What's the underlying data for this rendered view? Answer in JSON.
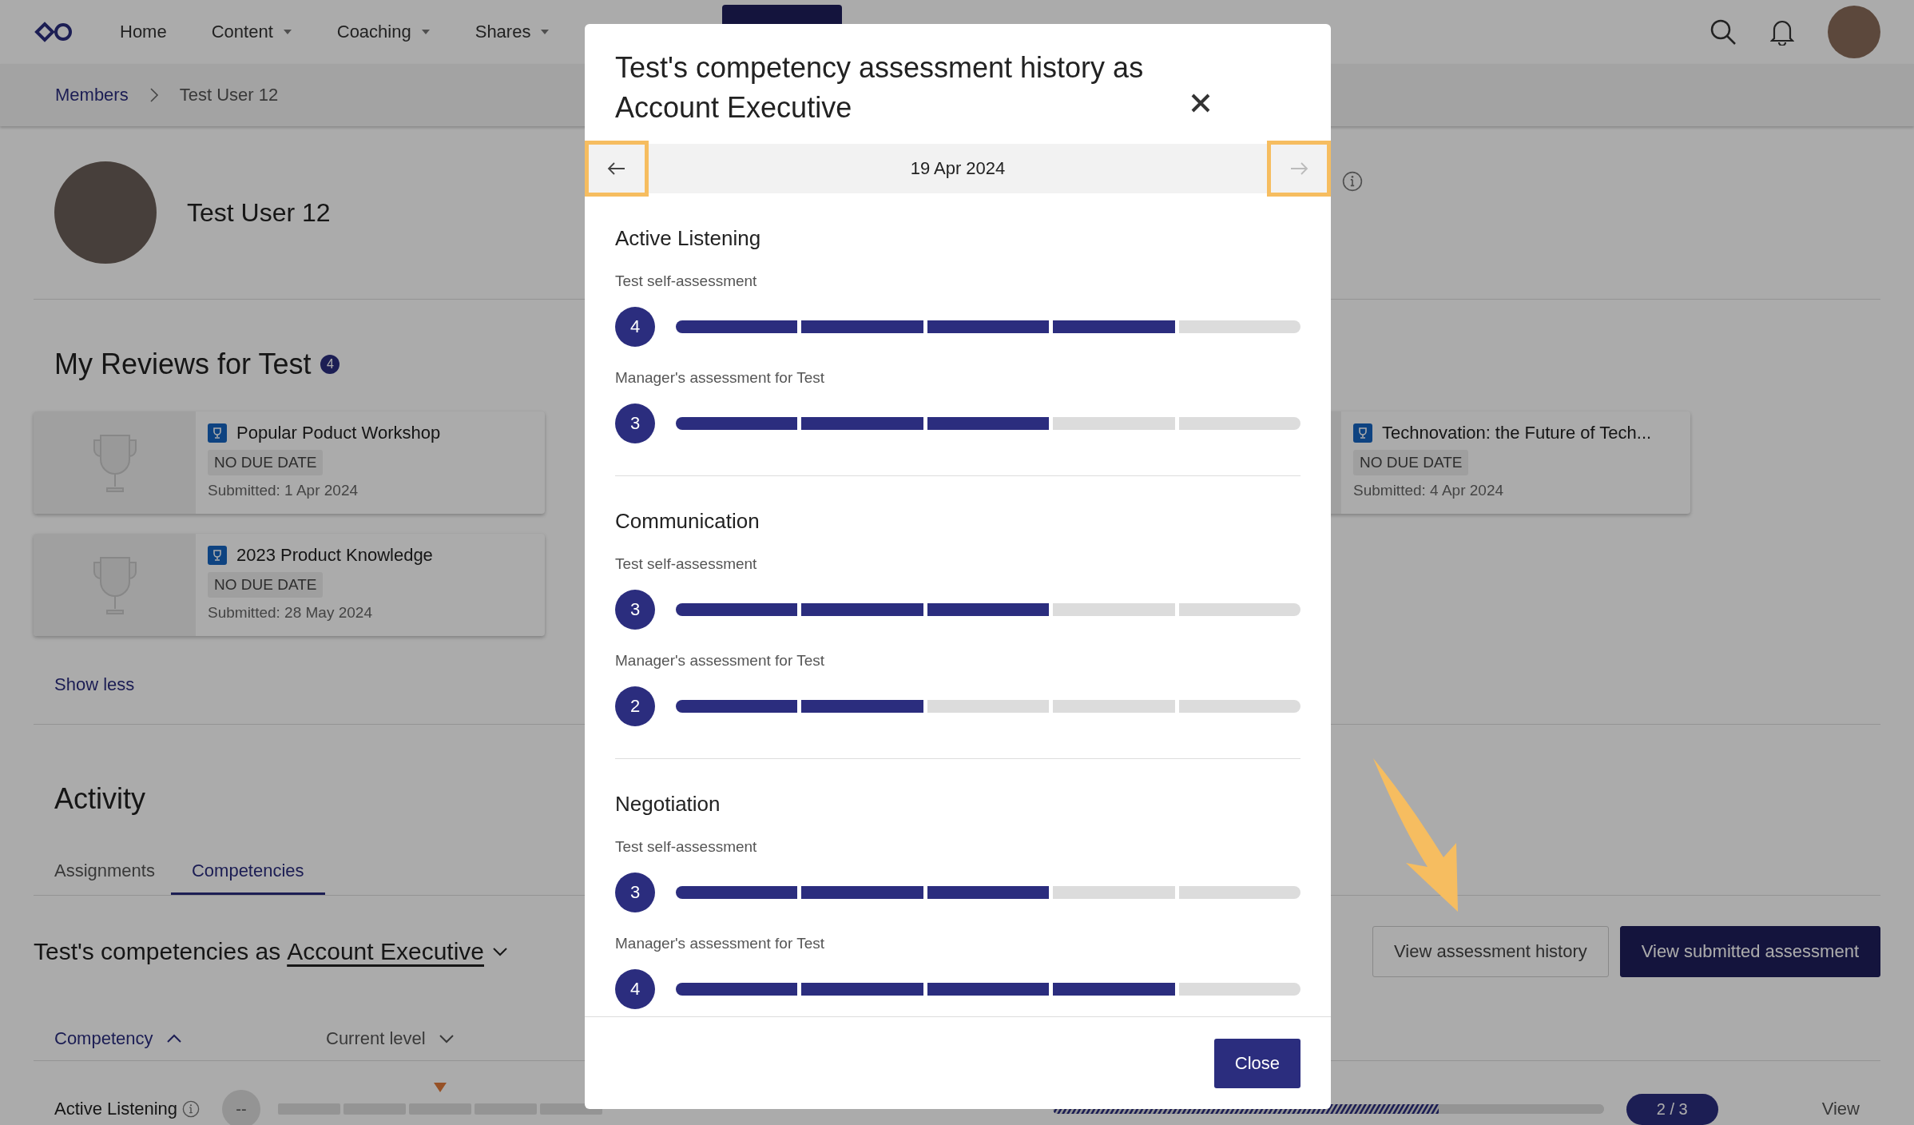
{
  "nav": {
    "items": [
      {
        "label": "Home",
        "dropdown": false
      },
      {
        "label": "Content",
        "dropdown": true
      },
      {
        "label": "Coaching",
        "dropdown": true
      },
      {
        "label": "Shares",
        "dropdown": true
      }
    ]
  },
  "breadcrumb": [
    {
      "label": "Members",
      "link": true
    },
    {
      "label": "Test User 12",
      "link": false
    }
  ],
  "profile": {
    "name": "Test User 12"
  },
  "reviews": {
    "title": "My Reviews for Test",
    "count": "4",
    "left_column": [
      {
        "title": "Popular Poduct Workshop",
        "due": "NO DUE DATE",
        "submitted": "Submitted: 1 Apr 2024"
      },
      {
        "title": "2023 Product Knowledge",
        "due": "NO DUE DATE",
        "submitted": "Submitted: 28 May 2024"
      }
    ],
    "right_column": [
      {
        "title": "Technovation: the Future of Tech...",
        "due": "NO DUE DATE",
        "submitted": "Submitted: 4 Apr 2024"
      }
    ],
    "show_less": "Show less"
  },
  "activity": {
    "title": "Activity",
    "tabs": [
      {
        "label": "Assignments",
        "selected": false
      },
      {
        "label": "Competencies",
        "selected": true
      }
    ],
    "heading": "Test's competencies as",
    "role": "Account Executive",
    "buttons": [
      {
        "label": "View assessment history",
        "kind": "secondary"
      },
      {
        "label": "View submitted assessment",
        "kind": "primary"
      }
    ],
    "columns": [
      {
        "label": "Competency",
        "sort_ascending": true,
        "selected": true
      },
      {
        "label": "Current level",
        "sort_ascending": false,
        "selected": false
      }
    ],
    "rows": [
      {
        "name": "Active Listening",
        "current": "--",
        "progress": "2 / 3",
        "level": 0.7,
        "action": "View"
      }
    ]
  },
  "modal": {
    "title": "Test's competency assessment history as Account Executive",
    "date": "19 Apr 2024",
    "prev_disabled": false,
    "next_disabled": true,
    "sections": [
      {
        "name": "Active Listening",
        "assessments": [
          {
            "label": "Test self-assessment",
            "score": "4",
            "level": 0.8
          },
          {
            "label": "Manager's assessment for Test",
            "score": "3",
            "level": 0.6
          }
        ]
      },
      {
        "name": "Communication",
        "assessments": [
          {
            "label": "Test self-assessment",
            "score": "3",
            "level": 0.6
          },
          {
            "label": "Manager's assessment for Test",
            "score": "2",
            "level": 0.4
          }
        ]
      },
      {
        "name": "Negotiation",
        "assessments": [
          {
            "label": "Test self-assessment",
            "score": "3",
            "level": 0.6
          },
          {
            "label": "Manager's assessment for Test",
            "score": "4",
            "level": 0.8
          }
        ]
      }
    ],
    "close_button": "Close"
  }
}
